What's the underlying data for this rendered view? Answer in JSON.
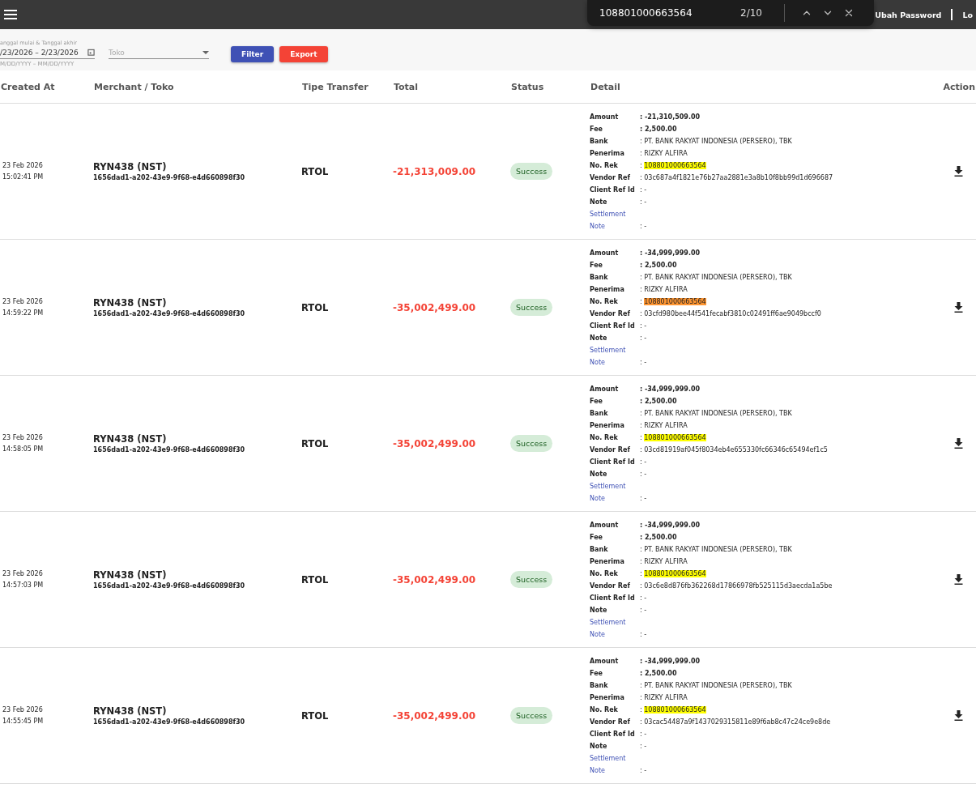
{
  "top_bar": {
    "links": [
      {
        "label": "Ubah Password"
      },
      {
        "label": "Lo"
      }
    ]
  },
  "find_bar": {
    "query": "108801000663564",
    "count": "2/10"
  },
  "filters": {
    "date_range": {
      "label": "anggal mulai & Tanggal akhir",
      "value": "/23/2026 – 2/23/2026",
      "hint": "M/DD/YYYY – MM/DD/YYYY"
    },
    "store": {
      "placeholder": "Toko"
    },
    "buttons": [
      {
        "label": "Filter",
        "kind": "primary"
      },
      {
        "label": "Export",
        "kind": "danger"
      }
    ]
  },
  "table": {
    "columns": [
      "Created At",
      "Merchant / Toko",
      "Tipe Transfer",
      "Total",
      "Status",
      "Detail",
      "Action"
    ],
    "rows": [
      {
        "date": "23 Feb 2026",
        "time": "15:02:41 PM",
        "merchant": "RYN438 (NST)",
        "merchant_id": "1656dad1-a202-43e9-9f68-e4d660898f30",
        "type": "RTOL",
        "total": "-21,313,009.00",
        "status": {
          "label": "Success",
          "kind": "success"
        },
        "details": [
          {
            "label": "Amount",
            "value": ": -21,310,509.00",
            "strong": true
          },
          {
            "label": "Fee",
            "value": ": 2,500.00",
            "strong": true
          },
          {
            "label": "Bank",
            "value": ": PT. BANK RAKYAT INDONESIA (PERSERO), TBK"
          },
          {
            "label": "Penerima",
            "value": ": RIZKY ALFIRA"
          },
          {
            "label": "No. Rek",
            "value": ": ",
            "match": "108801000663564",
            "selected": false
          },
          {
            "label": "Vendor Ref",
            "value": ": 03c687a4f1821e76b27aa2881e3a8b10f8bb99d1d696687"
          },
          {
            "label": "Client Ref Id",
            "value": ": -"
          },
          {
            "label": "Note",
            "value": ": -"
          },
          {
            "label": "Settlement",
            "link": true
          },
          {
            "label": "Note",
            "value": ": -",
            "link": true
          }
        ]
      },
      {
        "date": "23 Feb 2026",
        "time": "14:59:22 PM",
        "merchant": "RYN438 (NST)",
        "merchant_id": "1656dad1-a202-43e9-9f68-e4d660898f30",
        "type": "RTOL",
        "total": "-35,002,499.00",
        "status": {
          "label": "Success",
          "kind": "success"
        },
        "details": [
          {
            "label": "Amount",
            "value": ": -34,999,999.00",
            "strong": true
          },
          {
            "label": "Fee",
            "value": ": 2,500.00",
            "strong": true
          },
          {
            "label": "Bank",
            "value": ": PT. BANK RAKYAT INDONESIA (PERSERO), TBK"
          },
          {
            "label": "Penerima",
            "value": ": RIZKY ALFIRA"
          },
          {
            "label": "No. Rek",
            "value": ": ",
            "match": "108801000663564",
            "selected": true
          },
          {
            "label": "Vendor Ref",
            "value": ": 03cfd980bee44f541fecabf3810c02491ff6ae9049bccf0"
          },
          {
            "label": "Client Ref Id",
            "value": ": -"
          },
          {
            "label": "Note",
            "value": ": -"
          },
          {
            "label": "Settlement",
            "link": true
          },
          {
            "label": "Note",
            "value": ": -",
            "link": true
          }
        ]
      },
      {
        "date": "23 Feb 2026",
        "time": "14:58:05 PM",
        "merchant": "RYN438 (NST)",
        "merchant_id": "1656dad1-a202-43e9-9f68-e4d660898f30",
        "type": "RTOL",
        "total": "-35,002,499.00",
        "status": {
          "label": "Success",
          "kind": "success"
        },
        "details": [
          {
            "label": "Amount",
            "value": ": -34,999,999.00",
            "strong": true
          },
          {
            "label": "Fee",
            "value": ": 2,500.00",
            "strong": true
          },
          {
            "label": "Bank",
            "value": ": PT. BANK RAKYAT INDONESIA (PERSERO), TBK"
          },
          {
            "label": "Penerima",
            "value": ": RIZKY ALFIRA"
          },
          {
            "label": "No. Rek",
            "value": ": ",
            "match": "108801000663564",
            "selected": false
          },
          {
            "label": "Vendor Ref",
            "value": ": 03cd81919af045f8034eb4e655330fc66346c65494ef1c5"
          },
          {
            "label": "Client Ref Id",
            "value": ": -"
          },
          {
            "label": "Note",
            "value": ": -"
          },
          {
            "label": "Settlement",
            "link": true
          },
          {
            "label": "Note",
            "value": ": -",
            "link": true
          }
        ]
      },
      {
        "date": "23 Feb 2026",
        "time": "14:57:03 PM",
        "merchant": "RYN438 (NST)",
        "merchant_id": "1656dad1-a202-43e9-9f68-e4d660898f30",
        "type": "RTOL",
        "total": "-35,002,499.00",
        "status": {
          "label": "Success",
          "kind": "success"
        },
        "details": [
          {
            "label": "Amount",
            "value": ": -34,999,999.00",
            "strong": true
          },
          {
            "label": "Fee",
            "value": ": 2,500.00",
            "strong": true
          },
          {
            "label": "Bank",
            "value": ": PT. BANK RAKYAT INDONESIA (PERSERO), TBK"
          },
          {
            "label": "Penerima",
            "value": ": RIZKY ALFIRA"
          },
          {
            "label": "No. Rek",
            "value": ": ",
            "match": "108801000663564",
            "selected": false
          },
          {
            "label": "Vendor Ref",
            "value": ": 03c6e8d876fb362268d17866978fb525115d3aecda1a5be"
          },
          {
            "label": "Client Ref Id",
            "value": ": -"
          },
          {
            "label": "Note",
            "value": ": -"
          },
          {
            "label": "Settlement",
            "link": true
          },
          {
            "label": "Note",
            "value": ": -",
            "link": true
          }
        ]
      },
      {
        "date": "23 Feb 2026",
        "time": "14:55:45 PM",
        "merchant": "RYN438 (NST)",
        "merchant_id": "1656dad1-a202-43e9-9f68-e4d660898f30",
        "type": "RTOL",
        "total": "-35,002,499.00",
        "status": {
          "label": "Success",
          "kind": "success"
        },
        "details": [
          {
            "label": "Amount",
            "value": ": -34,999,999.00",
            "strong": true
          },
          {
            "label": "Fee",
            "value": ": 2,500.00",
            "strong": true
          },
          {
            "label": "Bank",
            "value": ": PT. BANK RAKYAT INDONESIA (PERSERO), TBK"
          },
          {
            "label": "Penerima",
            "value": ": RIZKY ALFIRA"
          },
          {
            "label": "No. Rek",
            "value": ": ",
            "match": "108801000663564",
            "selected": false
          },
          {
            "label": "Vendor Ref",
            "value": ": 03cac54487a9f14370293158​11e89f6ab8c47c24ce9e8de"
          },
          {
            "label": "Client Ref Id",
            "value": ": -"
          },
          {
            "label": "Note",
            "value": ": -"
          },
          {
            "label": "Settlement",
            "link": true
          },
          {
            "label": "Note",
            "value": ": -",
            "link": true
          }
        ]
      }
    ]
  }
}
